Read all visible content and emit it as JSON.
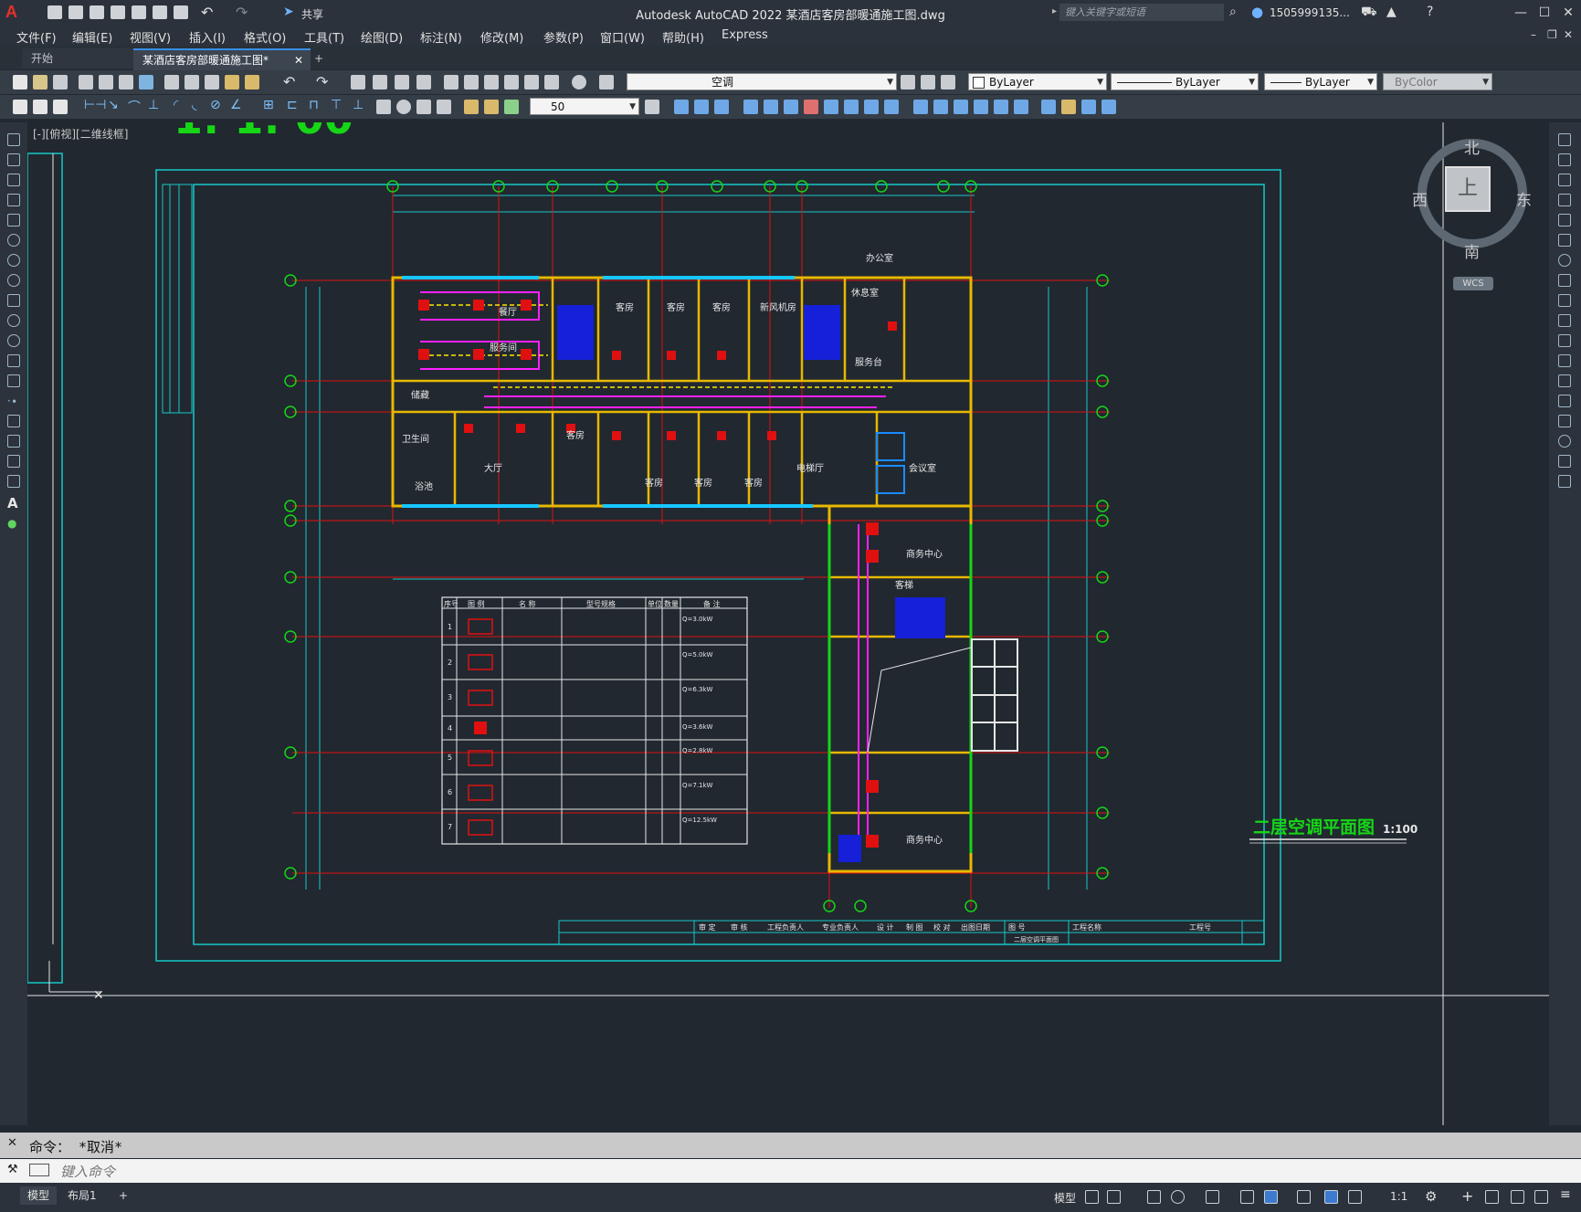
{
  "app": {
    "logo": "A",
    "title": "Autodesk AutoCAD 2022    某酒店客房部暖通施工图.dwg",
    "search_placeholder": "键入关键字或短语",
    "user": "1505999135...",
    "share_label": "共享"
  },
  "menu": [
    "文件(F)",
    "编辑(E)",
    "视图(V)",
    "插入(I)",
    "格式(O)",
    "工具(T)",
    "绘图(D)",
    "标注(N)",
    "修改(M)",
    "参数(P)",
    "窗口(W)",
    "帮助(H)",
    "Express"
  ],
  "tabs": {
    "start": "开始",
    "drawing": "某酒店客房部暖通施工图*",
    "add": "+"
  },
  "toolbar": {
    "layer_value": "空调",
    "color_value": "ByLayer",
    "linetype_value": "ByLayer",
    "lineweight_value": "ByLayer",
    "plotstyle_value": "ByColor",
    "dimscale_value": "50"
  },
  "viewport": {
    "view_label": "[-][俯视][二维线框]",
    "top_partial_text": "1: 1: 00",
    "viewcube": {
      "north": "北",
      "south": "南",
      "east": "东",
      "west": "西",
      "face": "上",
      "wcs": "WCS"
    }
  },
  "drawing": {
    "plan_title": "二层空调平面图",
    "plan_scale": "1:100",
    "rooms": [
      "客房",
      "客房",
      "客房",
      "新风机房",
      "休息室",
      "餐厅",
      "服务间",
      "服务台",
      "储藏",
      "卫生间",
      "浴池",
      "大厅",
      "客房",
      "客房",
      "客房",
      "客房",
      "电梯厅",
      "会议室",
      "商务中心",
      "商务中心",
      "办公室",
      "客梯"
    ],
    "equipment_table": {
      "headers": [
        "序号",
        "图 例",
        "名 称",
        "型号规格",
        "单位",
        "数量",
        "备 注"
      ],
      "rows": [
        {
          "no": "1",
          "unit_note": "Q=3.0kW"
        },
        {
          "no": "2",
          "unit_note": "Q=5.0kW"
        },
        {
          "no": "3",
          "unit_note": "Q=6.3kW"
        },
        {
          "no": "4",
          "unit_note": "Q=3.6kW"
        },
        {
          "no": "5",
          "unit_note": "Q=2.8kW"
        },
        {
          "no": "6",
          "unit_note": "Q=7.1kW"
        },
        {
          "no": "7",
          "unit_note": "Q=12.5kW"
        }
      ]
    },
    "title_block": [
      "审 定",
      "审 核",
      "工程负责人",
      "专业负责人",
      "设 计",
      "制 图",
      "校 对",
      "出图日期",
      "图 号",
      "二层空调平面图",
      "工程名称",
      "工程号"
    ]
  },
  "command": {
    "history": "命令：  *取消*",
    "placeholder": "键入命令"
  },
  "status": {
    "model_tab": "模型",
    "layout_tab": "布局1",
    "add": "+",
    "model_label": "模型",
    "scale": "1:1"
  }
}
